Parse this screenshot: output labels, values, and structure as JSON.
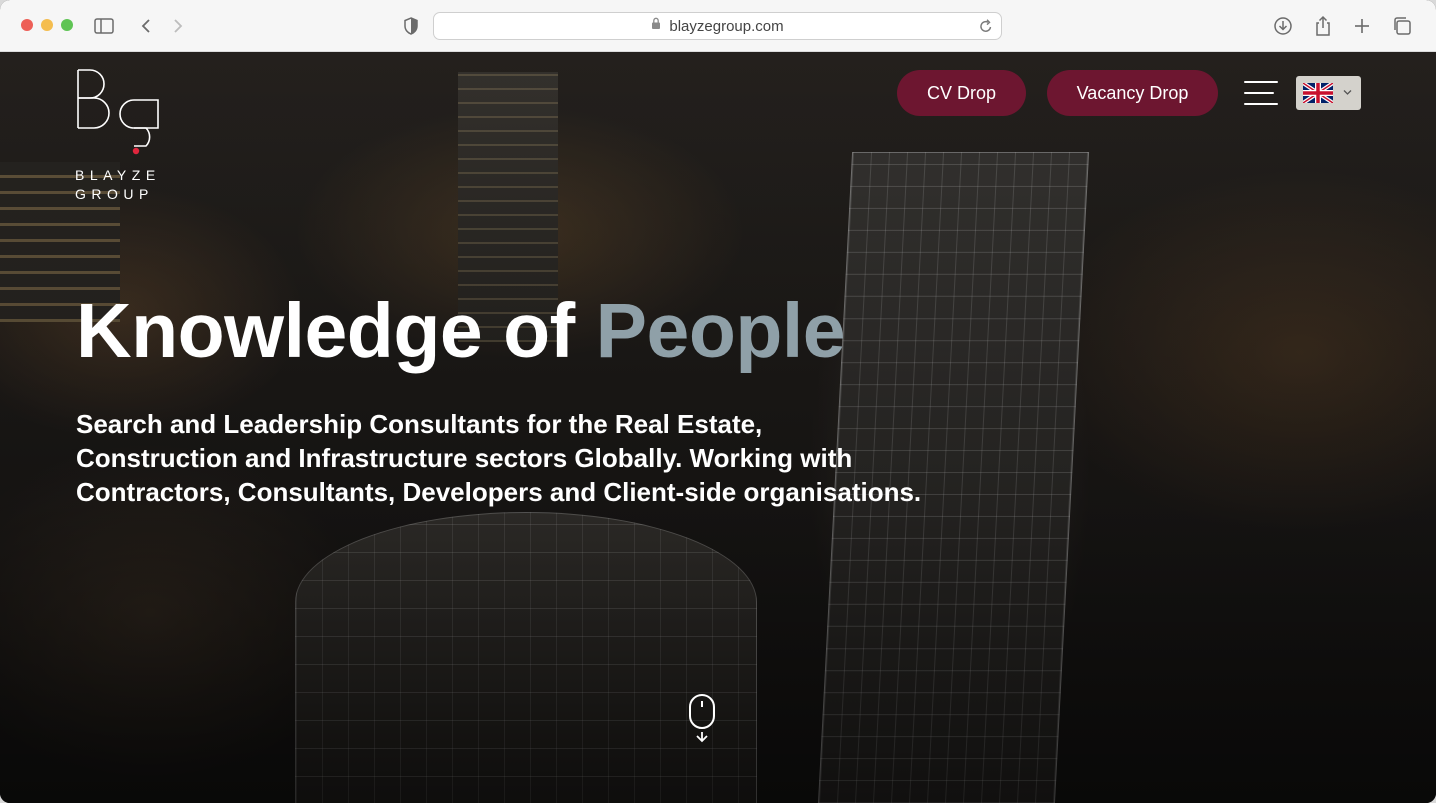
{
  "browser": {
    "url": "blayzegroup.com"
  },
  "site": {
    "logo_line1": "BLAYZE",
    "logo_line2": "GROUP",
    "cv_drop_label": "CV Drop",
    "vacancy_drop_label": "Vacancy Drop",
    "language": "en-GB",
    "brand_color": "#6d1630"
  },
  "hero": {
    "headline_part1": "Knowledge of ",
    "headline_part2": "People",
    "accent_color": "#8fa0a8",
    "subtext": "Search and Leadership Consultants for the Real Estate, Construction and Infrastructure sectors Globally. Working with Contractors, Consultants, Developers and Client-side organisations."
  },
  "icons": [
    "sidebar-icon",
    "back-icon",
    "forward-icon",
    "shield-icon",
    "lock-icon",
    "reload-icon",
    "download-icon",
    "share-icon",
    "new-tab-icon",
    "tabs-overview-icon",
    "hamburger-menu-icon",
    "uk-flag-icon",
    "chevron-down-icon",
    "mouse-scroll-icon"
  ]
}
